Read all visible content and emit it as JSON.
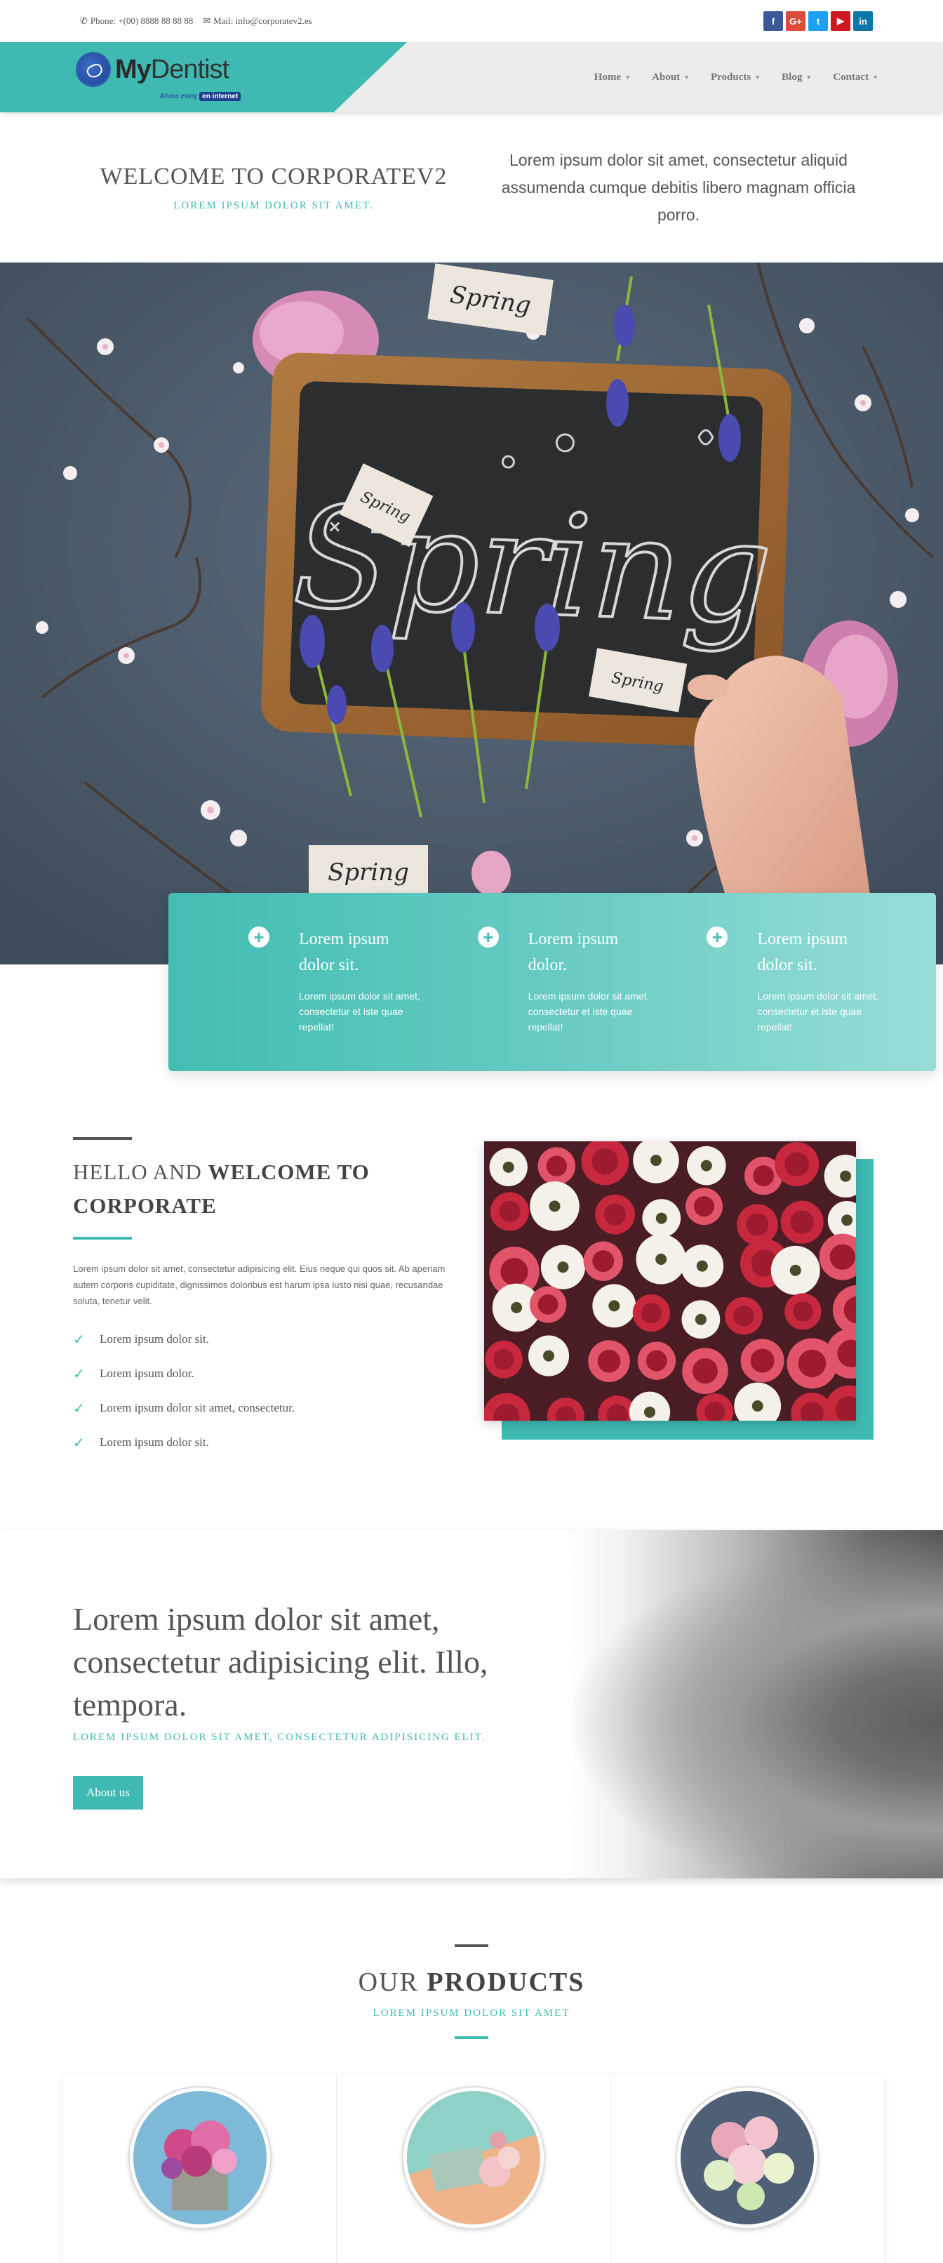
{
  "topbar": {
    "phone": "Phone: +(00) 8888 88 88 88",
    "mail": "Mail: info@corporatev2.es",
    "socials": [
      {
        "icon": "facebook-icon",
        "glyph": "f",
        "color": "#3b5998"
      },
      {
        "icon": "google-plus-icon",
        "glyph": "G+",
        "color": "#dd4b39"
      },
      {
        "icon": "twitter-icon",
        "glyph": "t",
        "color": "#1da1f2"
      },
      {
        "icon": "youtube-icon",
        "glyph": "▶",
        "color": "#cc181e"
      },
      {
        "icon": "linkedin-icon",
        "glyph": "in",
        "color": "#0e76a8"
      }
    ]
  },
  "brand": {
    "name_strong": "My",
    "name_rest": "Dentist",
    "tag_prefix": "Ahora estoy",
    "tag_badge": "en internet"
  },
  "nav": {
    "items": [
      {
        "label": "Home"
      },
      {
        "label": "About"
      },
      {
        "label": "Products"
      },
      {
        "label": "Blog"
      },
      {
        "label": "Contact"
      }
    ]
  },
  "welcome": {
    "title": "WELCOME TO CORPORATEV2",
    "subtitle": "LOREM IPSUM DOLOR SIT AMET.",
    "text": "Lorem ipsum dolor sit amet, consectetur aliquid assumenda cumque debitis libero magnam officia porro."
  },
  "hero": {
    "chalk_word": "Spring",
    "tags": [
      "Spring",
      "Spring",
      "Spring",
      "Spring"
    ]
  },
  "features": [
    {
      "title": "Lorem ipsum dolor sit.",
      "text": "Lorem ipsum dolor sit amet, consectetur et iste quae repellat!"
    },
    {
      "title": "Lorem ipsum dolor.",
      "text": "Lorem ipsum dolor sit amet, consectetur et iste quae repellat!"
    },
    {
      "title": "Lorem ipsum dolor sit.",
      "text": "Lorem ipsum dolor sit amet, consectetur et iste quae repellat!"
    }
  ],
  "about": {
    "title_light": "HELLO AND ",
    "title_bold": "WELCOME TO CORPORATE",
    "text": "Lorem ipsum dolor sit amet, consectetur adipisicing elit. Eius neque qui quos sit. Ab aperiam autem corporis cupiditate, dignissimos doloribus est harum ipsa iusto nisi quae, recusandae soluta, tenetur velit.",
    "list": [
      "Lorem ipsum dolor sit.",
      "Lorem ipsum dolor.",
      "Lorem ipsum dolor sit amet, consectetur.",
      "Lorem ipsum dolor sit."
    ]
  },
  "cta": {
    "title": "Lorem ipsum dolor sit amet, consectetur adipisicing elit. Illo, tempora.",
    "subtitle": "LOREM IPSUM DOLOR SIT AMET, CONSECTETUR ADIPISICING ELIT.",
    "button": "About us"
  },
  "products": {
    "title_light": "OUR ",
    "title_bold": "PRODUCTS",
    "subtitle": "LOREM IPSUM DOLOR SIT AMET"
  },
  "colors": {
    "accent": "#3fbab3",
    "text": "#555555"
  }
}
